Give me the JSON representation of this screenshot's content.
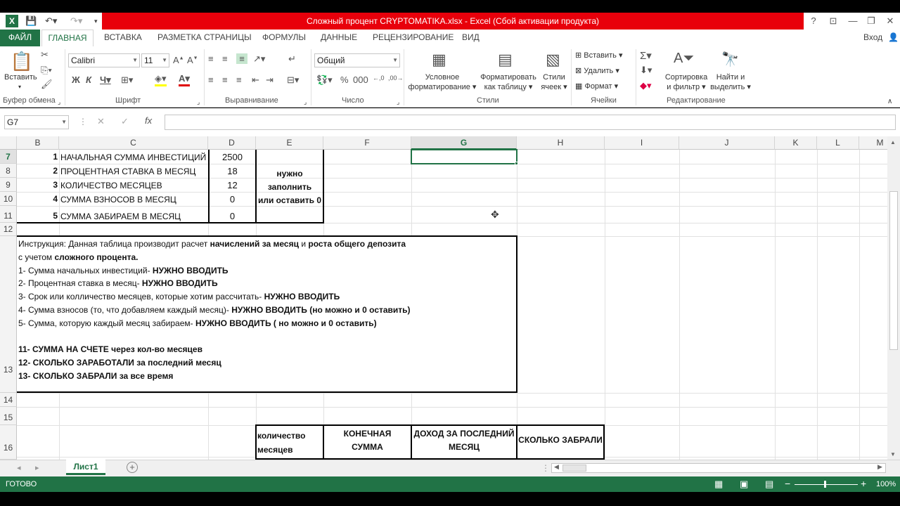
{
  "app": {
    "window_title": "Сложный процент CRYPTOMATIKA.xlsx -  Excel (Сбой активации продукта)",
    "signin": "Вход"
  },
  "tabs": [
    "ФАЙЛ",
    "ГЛАВНАЯ",
    "ВСТАВКА",
    "РАЗМЕТКА СТРАНИЦЫ",
    "ФОРМУЛЫ",
    "ДАННЫЕ",
    "РЕЦЕНЗИРОВАНИЕ",
    "ВИД"
  ],
  "ribbon": {
    "paste": "Вставить",
    "font_name": "Calibri",
    "font_size": "11",
    "number_format": "Общий",
    "cond_fmt_1": "Условное",
    "cond_fmt_2": "форматирование",
    "fmt_table_1": "Форматировать",
    "fmt_table_2": "как таблицу",
    "styles_1": "Стили",
    "styles_2": "ячеек",
    "insert": "Вставить",
    "delete": "Удалить",
    "format": "Формат",
    "sort_1": "Сортировка",
    "sort_2": "и фильтр",
    "find_1": "Найти и",
    "find_2": "выделить",
    "groups": {
      "clipboard": "Буфер обмена",
      "font": "Шрифт",
      "align": "Выравнивание",
      "number": "Число",
      "styles": "Стили",
      "cells": "Ячейки",
      "editing": "Редактирование"
    }
  },
  "formula_bar": {
    "name_box": "G7",
    "formula": ""
  },
  "columns": [
    "B",
    "C",
    "D",
    "E",
    "F",
    "G",
    "H",
    "I",
    "J",
    "K",
    "L",
    "M"
  ],
  "rows": [
    "7",
    "8",
    "9",
    "10",
    "11",
    "12",
    "13",
    "14",
    "15",
    "16"
  ],
  "params": [
    {
      "n": "1",
      "label": "НАЧАЛЬНАЯ СУММА ИНВЕСТИЦИЙ",
      "value": "2500"
    },
    {
      "n": "2",
      "label": "ПРОЦЕНТНАЯ СТАВКА В МЕСЯЦ",
      "value": "18"
    },
    {
      "n": "3",
      "label": "КОЛИЧЕСТВО МЕСЯЦЕВ",
      "value": "12"
    },
    {
      "n": "4",
      "label": "СУММА ВЗНОСОВ В МЕСЯЦ",
      "value": "0"
    },
    {
      "n": "5",
      "label": "СУММА ЗАБИРАЕМ В МЕСЯЦ",
      "value": "0"
    }
  ],
  "note": [
    "нужно",
    "заполнить",
    "или оставить 0"
  ],
  "instructions": [
    {
      "t": "Инструкция: Данная таблица производит расчет ",
      "b": "начислений за месяц",
      "t2": " и ",
      "b2": "роста общего депозита"
    },
    {
      "t": " с учетом ",
      "b": "сложного процента.",
      "t2": "",
      "b2": ""
    },
    {
      "t": "1- Сумма начальных инвестиций- ",
      "b": "НУЖНО ВВОДИТЬ",
      "t2": "",
      "b2": ""
    },
    {
      "t": "2- Процентная ставка в месяц- ",
      "b": "НУЖНО ВВОДИТЬ",
      "t2": "",
      "b2": ""
    },
    {
      "t": "3- Срок или колличество месяцев, которые хотим рассчитать- ",
      "b": "НУЖНО ВВОДИТЬ",
      "t2": "",
      "b2": ""
    },
    {
      "t": "4- Сумма взносов (то, что добавляем каждый месяц)- ",
      "b": "НУЖНО ВВОДИТЬ (но можно и 0 оставить)",
      "t2": "",
      "b2": ""
    },
    {
      "t": "5- Сумма, которую каждый месяц забираем- ",
      "b": "НУЖНО ВВОДИТЬ ( но можно и 0 оставить)",
      "t2": "",
      "b2": ""
    },
    {
      "t": "",
      "b": "",
      "t2": "",
      "b2": ""
    },
    {
      "t": "",
      "b": "11- СУММА НА СЧЕТЕ ",
      "t2": "",
      "b2": "через кол-во месяцев"
    },
    {
      "t": "",
      "b": "12- СКОЛЬКО ЗАРАБОТАЛИ за последний месяц",
      "t2": "",
      "b2": ""
    },
    {
      "t": "",
      "b": "13- СКОЛЬКО ЗАБРАЛИ за все время",
      "t2": "",
      "b2": ""
    }
  ],
  "result_headers": {
    "months_1": "количество",
    "months_2": "месяцев",
    "final_1": "КОНЕЧНАЯ",
    "final_2": "СУММА",
    "income_1": "ДОХОД ЗА ПОСЛЕДНИЙ",
    "income_2": "МЕСЯЦ",
    "taken": "СКОЛЬКО ЗАБРАЛИ"
  },
  "sheet_tab": "Лист1",
  "status": {
    "ready": "ГОТОВО",
    "zoom": "100%"
  },
  "colors": {
    "excel_green": "#217346",
    "title_red": "#e8000b"
  }
}
